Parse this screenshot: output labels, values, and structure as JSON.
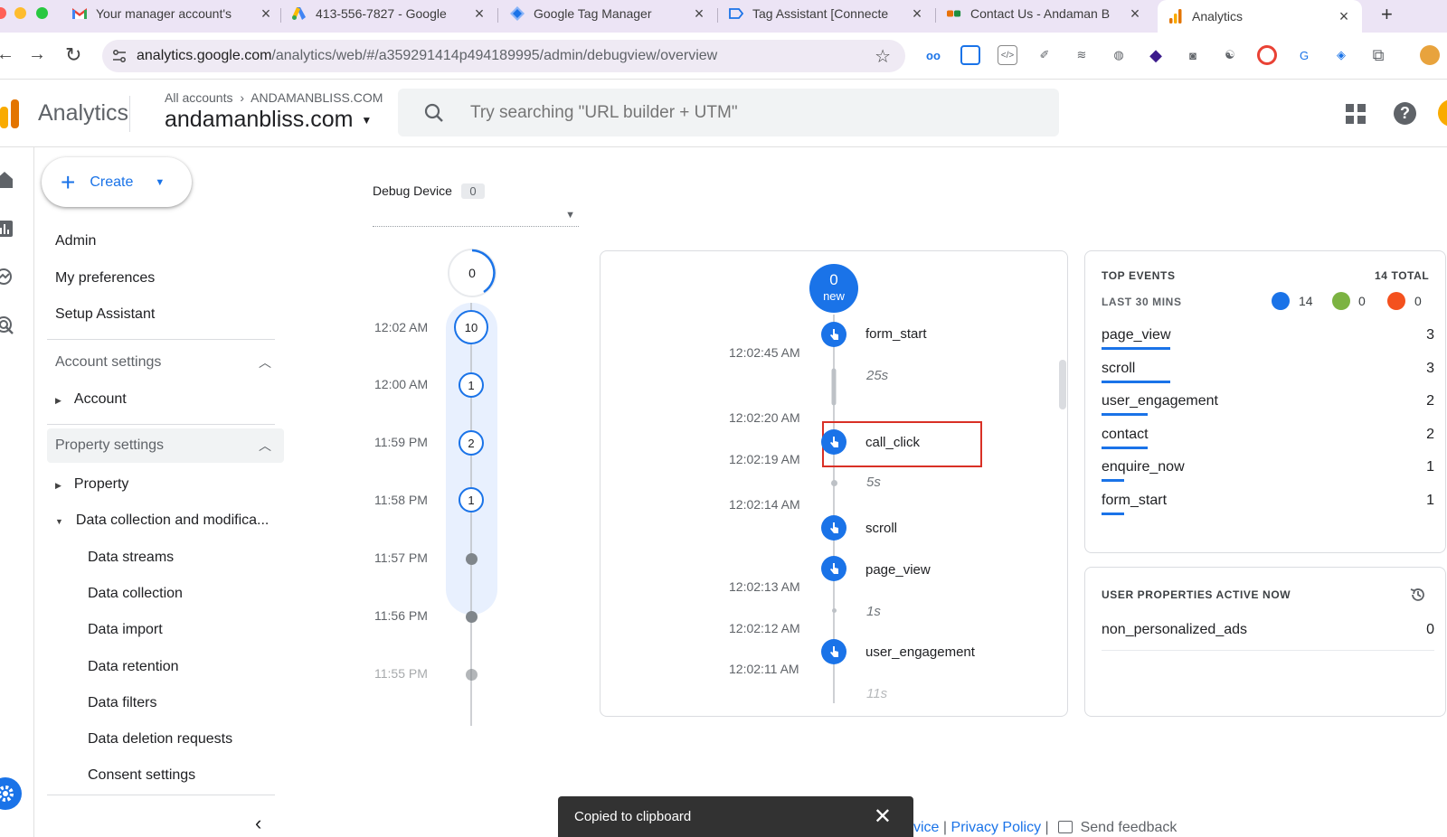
{
  "browser": {
    "tabs": [
      {
        "title": "Your manager account's",
        "favicon": "gmail-icon"
      },
      {
        "title": "413-556-7827 - Google",
        "favicon": "google-ads-icon"
      },
      {
        "title": "Google Tag Manager",
        "favicon": "tag-manager-icon"
      },
      {
        "title": "Tag Assistant [Connecte",
        "favicon": "tag-assistant-icon"
      },
      {
        "title": "Contact Us - Andaman B",
        "favicon": "andaman-icon"
      },
      {
        "title": "Analytics",
        "favicon": "analytics-icon",
        "active": true
      }
    ],
    "url_host": "analytics.google.com",
    "url_path": "/analytics/web/#/a359291414p494189995/admin/debugview/overview"
  },
  "header": {
    "product": "Analytics",
    "breadcrumb_root": "All accounts",
    "breadcrumb_account": "ANDAMANBLISS.COM",
    "property": "andamanbliss.com",
    "search_placeholder": "Try searching \"URL builder + UTM\""
  },
  "nav": {
    "create_label": "Create",
    "admin": "Admin",
    "my_preferences": "My preferences",
    "setup_assistant": "Setup Assistant",
    "account_settings": "Account settings",
    "account": "Account",
    "property_settings": "Property settings",
    "property": "Property",
    "data_collection_modification": "Data collection and modifica...",
    "sub_items": [
      "Data streams",
      "Data collection",
      "Data import",
      "Data retention",
      "Data filters",
      "Data deletion requests",
      "Consent settings"
    ]
  },
  "debug": {
    "device_label": "Debug Device",
    "device_count": "0",
    "top_bubble": "0",
    "minutes": [
      {
        "time": "12:02 AM",
        "count": "10"
      },
      {
        "time": "12:00 AM",
        "count": "1"
      },
      {
        "time": "11:59 PM",
        "count": "2"
      },
      {
        "time": "11:58 PM",
        "count": "1"
      },
      {
        "time": "11:57 PM",
        "count": ""
      },
      {
        "time": "11:56 PM",
        "count": ""
      },
      {
        "time": "11:55 PM",
        "count": ""
      }
    ]
  },
  "stream": {
    "new_count": "0",
    "new_label": "new",
    "events": [
      {
        "name": "form_start"
      },
      {
        "name": "call_click"
      },
      {
        "name": "scroll"
      },
      {
        "name": "page_view"
      },
      {
        "name": "user_engagement"
      }
    ],
    "times": [
      "12:02:45 AM",
      "12:02:20 AM",
      "12:02:19 AM",
      "12:02:14 AM",
      "12:02:13 AM",
      "12:02:12 AM",
      "12:02:11 AM"
    ],
    "durations": [
      "25s",
      "5s",
      "1s",
      "11s"
    ]
  },
  "top_events": {
    "title": "TOP EVENTS",
    "total": "14 TOTAL",
    "range": "LAST 30 MINS",
    "counts": {
      "events": "14",
      "conversions": "0",
      "errors": "0"
    },
    "rows": [
      {
        "name": "page_view",
        "count": "3",
        "share": 0.214
      },
      {
        "name": "scroll",
        "count": "3",
        "share": 0.214
      },
      {
        "name": "user_engagement",
        "count": "2",
        "share": 0.143
      },
      {
        "name": "contact",
        "count": "2",
        "share": 0.143
      },
      {
        "name": "enquire_now",
        "count": "1",
        "share": 0.071
      },
      {
        "name": "form_start",
        "count": "1",
        "share": 0.071
      }
    ]
  },
  "user_props": {
    "title": "USER PROPERTIES ACTIVE NOW",
    "rows": [
      {
        "name": "non_personalized_ads",
        "value": "0"
      }
    ]
  },
  "toast": {
    "message": "Copied to clipboard"
  },
  "footer": {
    "link1": "vice",
    "link2": "Privacy Policy",
    "feedback": "Send feedback"
  },
  "colors": {
    "accent": "#1a73e8",
    "highlight": "#d93025",
    "conversion": "#7cb342",
    "error": "#f4511e"
  }
}
